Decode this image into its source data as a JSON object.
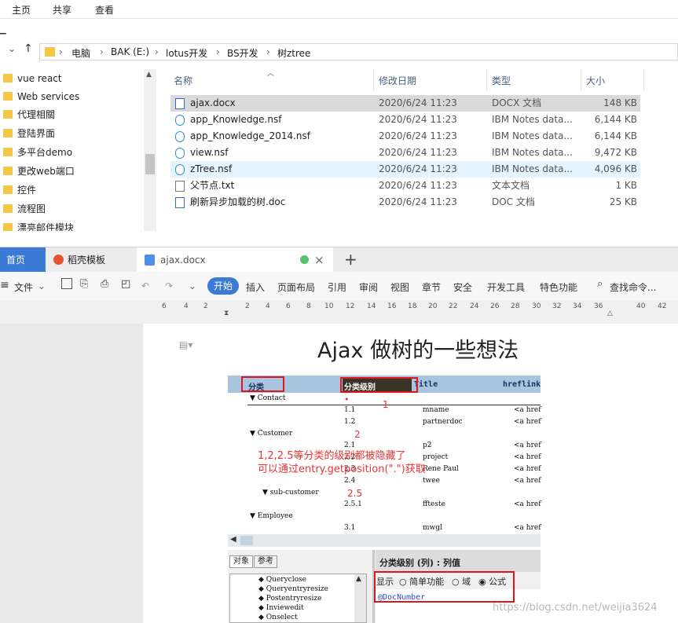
{
  "explorer": {
    "ribbon_tabs": [
      "主页",
      "共享",
      "查看"
    ],
    "breadcrumb": [
      "电脑",
      "BAK (E:)",
      "lotus开发",
      "BS开发",
      "树ztree"
    ],
    "nav_items": [
      "vue react",
      "Web services",
      "代理相關",
      "登陆界面",
      "多平台demo",
      "更改web端口",
      "控件",
      "流程图",
      "漂亮邮件模块"
    ],
    "columns": [
      "名称",
      "修改日期",
      "类型",
      "大小"
    ],
    "files": [
      {
        "name": "ajax.docx",
        "date": "2020/6/24 11:23",
        "type": "DOCX 文档",
        "size": "148 KB",
        "icon": "word-doc-icon"
      },
      {
        "name": "app_Knowledge.nsf",
        "date": "2020/6/24 11:23",
        "type": "IBM Notes data...",
        "size": "6,144 KB",
        "icon": "notes-db-icon"
      },
      {
        "name": "app_Knowledge_2014.nsf",
        "date": "2020/6/24 11:23",
        "type": "IBM Notes data...",
        "size": "6,144 KB",
        "icon": "notes-db-icon"
      },
      {
        "name": "view.nsf",
        "date": "2020/6/24 11:23",
        "type": "IBM Notes data...",
        "size": "9,472 KB",
        "icon": "notes-db-icon"
      },
      {
        "name": "zTree.nsf",
        "date": "2020/6/24 11:23",
        "type": "IBM Notes data...",
        "size": "4,096 KB",
        "icon": "notes-db-icon"
      },
      {
        "name": "父节点.txt",
        "date": "2020/6/24 11:23",
        "type": "文本文档",
        "size": "1 KB",
        "icon": "text-file-icon"
      },
      {
        "name": "刷新异步加载的树.doc",
        "date": "2020/6/24 11:23",
        "type": "DOC 文档",
        "size": "25 KB",
        "icon": "word-doc-icon"
      }
    ]
  },
  "wps": {
    "tabs": [
      "首页",
      "稻壳模板",
      "ajax.docx"
    ],
    "menu": [
      "文件",
      "开始",
      "插入",
      "页面布局",
      "引用",
      "审阅",
      "视图",
      "章节",
      "安全",
      "开发工具",
      "特色功能",
      "查找命令..."
    ],
    "ruler": [
      "6",
      "4",
      "2",
      "2",
      "4",
      "6",
      "8",
      "10",
      "12",
      "14",
      "16",
      "18",
      "20",
      "22",
      "24",
      "26",
      "28",
      "30",
      "32",
      "34",
      "36",
      "40",
      "42"
    ],
    "doc_title": "Ajax 做树的一些想法"
  },
  "notes": {
    "headers": [
      "分类",
      "分类级别",
      "Title",
      "hreflink"
    ],
    "rows": [
      {
        "cat": "Contact",
        "level": "",
        "title": "",
        "href": ""
      },
      {
        "cat": "",
        "level": "1.1",
        "title": "mname",
        "href": "<a href"
      },
      {
        "cat": "",
        "level": "1.2",
        "title": "partnerdoc",
        "href": "<a href"
      },
      {
        "cat": "Customer",
        "level": "",
        "title": "",
        "href": ""
      },
      {
        "cat": "",
        "level": "2.1",
        "title": "p2",
        "href": "<a href"
      },
      {
        "cat": "",
        "level": "2.2",
        "title": "project",
        "href": "<a href"
      },
      {
        "cat": "",
        "level": "2.3",
        "title": "Rene Paul",
        "href": "<a href"
      },
      {
        "cat": "",
        "level": "2.4",
        "title": "twee",
        "href": "<a href"
      },
      {
        "cat": "sub-customer",
        "level": "",
        "title": "",
        "href": ""
      },
      {
        "cat": "",
        "level": "2.5.1",
        "title": "ffteste",
        "href": "<a href"
      },
      {
        "cat": "Employee",
        "level": "",
        "title": "",
        "href": ""
      },
      {
        "cat": "",
        "level": "3.1",
        "title": "mwgl",
        "href": "<a href"
      }
    ],
    "annotations": [
      "1",
      "2",
      "2.5"
    ],
    "note_line1": "1,2,2.5等分类的级别都被隐藏了",
    "note_line2": "可以通过entry.getposition(\".\")获取",
    "lower_tabs": [
      "对象",
      "参考"
    ],
    "events": [
      "Queryclose",
      "Queryentryresize",
      "Postentryresize",
      "Inviewedit",
      "Onselect"
    ],
    "panel_title": "分类级别 (列) : 列值",
    "show_label": "显示",
    "radio": [
      "简单功能",
      "域",
      "公式"
    ],
    "formula": "@DocNumber"
  },
  "watermark": "https://blog.csdn.net/weijia3624"
}
